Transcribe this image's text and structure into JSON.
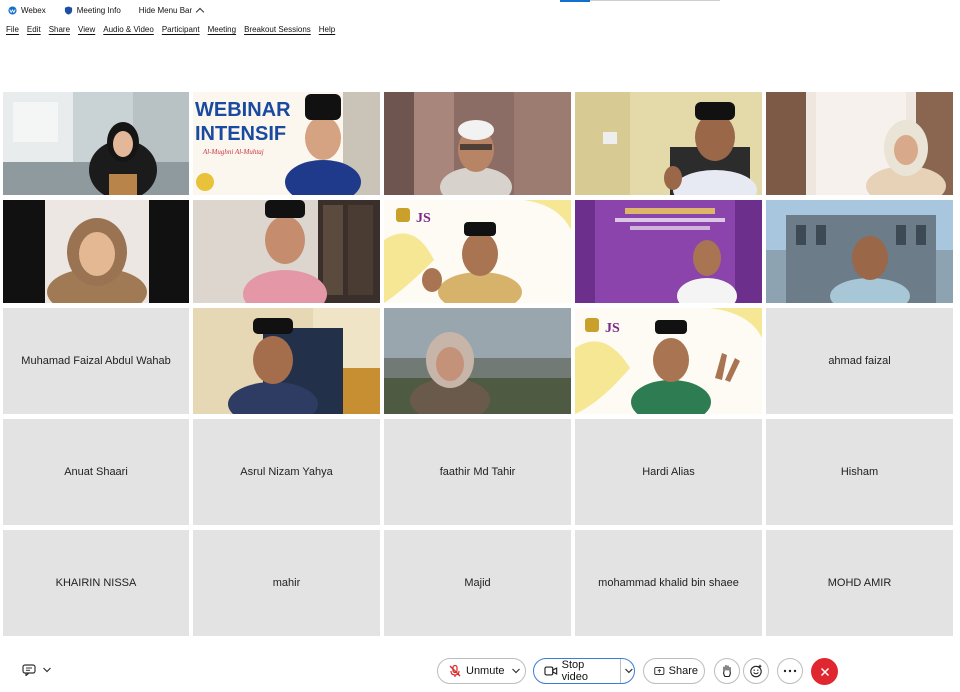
{
  "titlebar": {
    "app": "Webex",
    "meeting_info": "Meeting Info",
    "hide_menu": "Hide Menu Bar"
  },
  "menu": [
    "File",
    "Edit",
    "Share",
    "View",
    "Audio & Video",
    "Participant",
    "Meeting",
    "Breakout Sessions",
    "Help"
  ],
  "video_text": {
    "t2_line1": "WEBINAR",
    "t2_line2": "INTENSIF",
    "t2_line3": "Al-Mughni Al-Muhtaj"
  },
  "participants_no_video": [
    "Muhamad Faizal Abdul Wahab",
    "ahmad faizal",
    "Anuat Shaari",
    "Asrul Nizam Yahya",
    "faathir Md Tahir",
    "Hardi Alias",
    "Hisham",
    "KHAIRIN NISSA",
    "mahir",
    "Majid",
    "mohammad khalid bin shaee",
    "MOHD AMIR"
  ],
  "controls": {
    "unmute": "Unmute",
    "stop_video": "Stop video",
    "share": "Share"
  },
  "colors": {
    "tile_bg": "#e3e3e3",
    "accent_blue": "#1170cf",
    "end_red": "#e0262f"
  }
}
